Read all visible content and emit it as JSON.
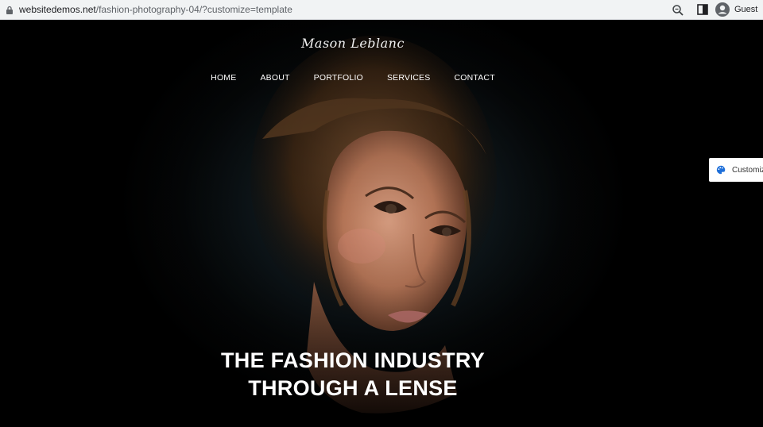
{
  "browser": {
    "url_host": "websitedemos.net",
    "url_path": "/fashion-photography-04/?customize=template",
    "profile_label": "Guest",
    "icons": [
      "lock-icon",
      "zoom-icon",
      "side-panel-icon",
      "profile-icon"
    ]
  },
  "site": {
    "logo": "Mason Leblanc",
    "nav": [
      {
        "label": "HOME"
      },
      {
        "label": "ABOUT"
      },
      {
        "label": "PORTFOLIO"
      },
      {
        "label": "SERVICES"
      },
      {
        "label": "CONTACT"
      }
    ],
    "headline_line1": "THE FASHION INDUSTRY",
    "headline_line2": "THROUGH A LENSE"
  },
  "customize": {
    "label": "Customize",
    "icon": "palette-icon"
  },
  "colors": {
    "background": "#000000",
    "customize_icon": "#1e6fd9"
  }
}
